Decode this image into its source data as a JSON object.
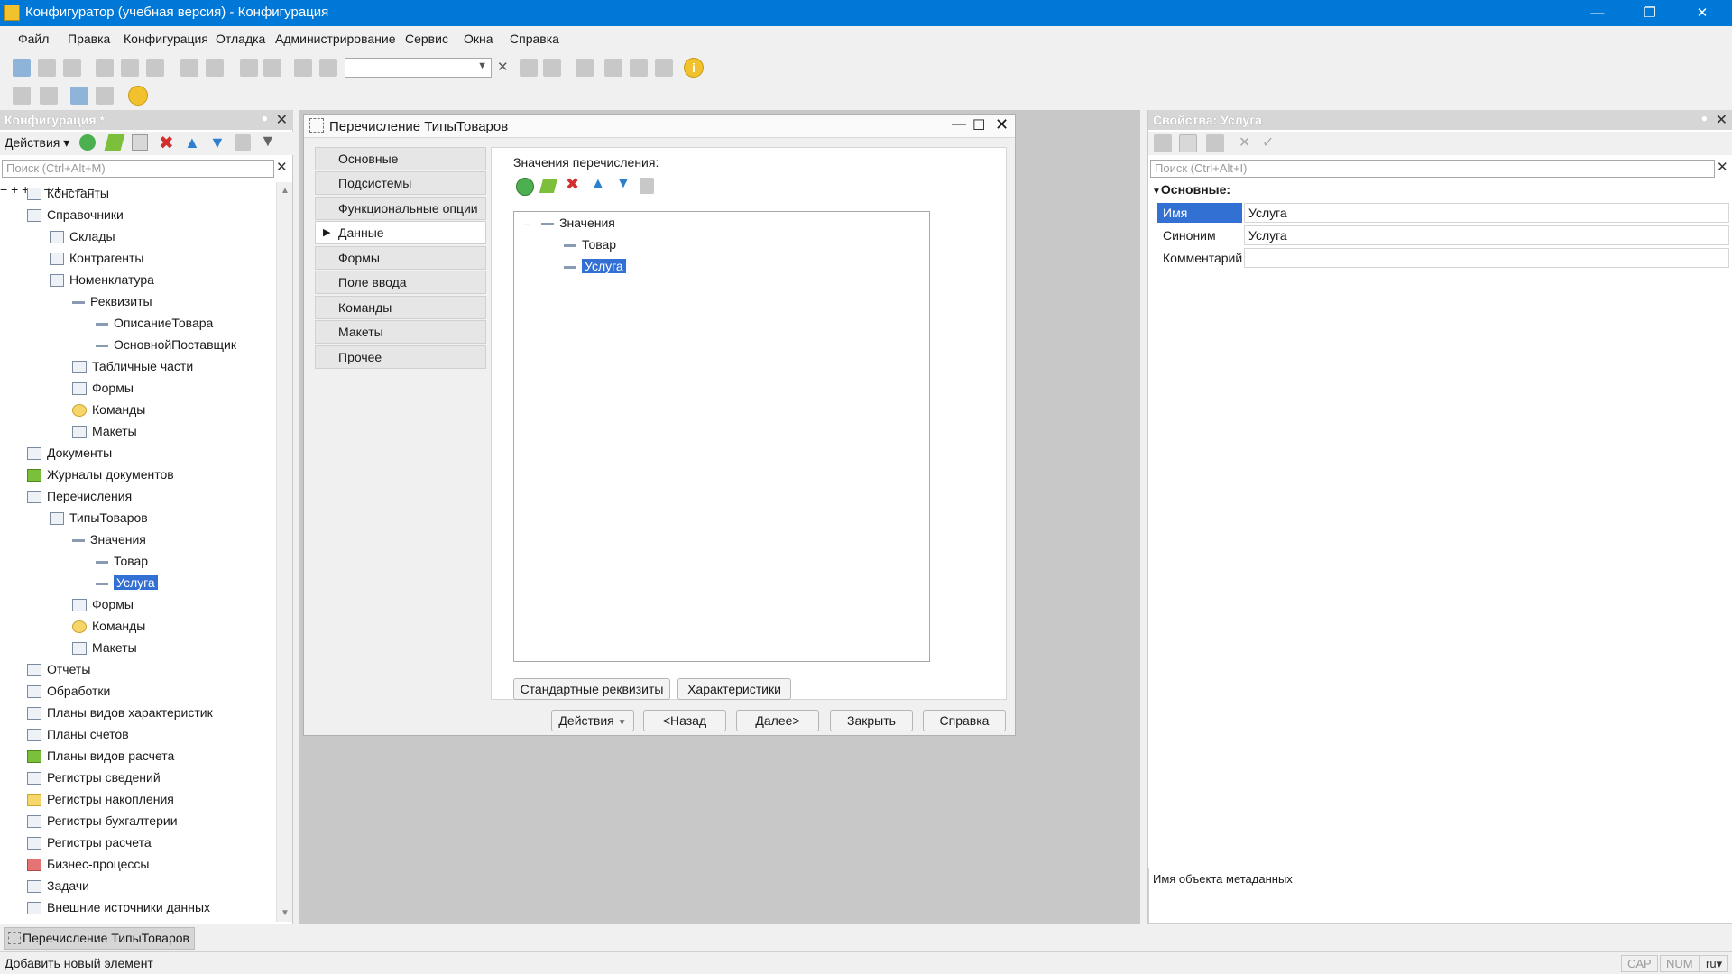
{
  "window": {
    "title": "Конфигуратор (учебная версия) - Конфигурация"
  },
  "menu": [
    "Файл",
    "Правка",
    "Конфигурация",
    "Отладка",
    "Администрирование",
    "Сервис",
    "Окна",
    "Справка"
  ],
  "left_panel": {
    "title": "Конфигурация *",
    "actions_label": "Действия",
    "search_placeholder": "Поиск (Ctrl+Alt+M)",
    "tree": [
      {
        "label": "Константы"
      },
      {
        "label": "Справочники"
      },
      {
        "label": "Склады"
      },
      {
        "label": "Контрагенты"
      },
      {
        "label": "Номенклатура"
      },
      {
        "label": "Реквизиты"
      },
      {
        "label": "ОписаниеТовара"
      },
      {
        "label": "ОсновнойПоставщик"
      },
      {
        "label": "Табличные части"
      },
      {
        "label": "Формы"
      },
      {
        "label": "Команды"
      },
      {
        "label": "Макеты"
      },
      {
        "label": "Документы"
      },
      {
        "label": "Журналы документов"
      },
      {
        "label": "Перечисления"
      },
      {
        "label": "ТипыТоваров"
      },
      {
        "label": "Значения"
      },
      {
        "label": "Товар"
      },
      {
        "label": "Услуга"
      },
      {
        "label": "Формы"
      },
      {
        "label": "Команды"
      },
      {
        "label": "Макеты"
      },
      {
        "label": "Отчеты"
      },
      {
        "label": "Обработки"
      },
      {
        "label": "Планы видов характеристик"
      },
      {
        "label": "Планы счетов"
      },
      {
        "label": "Планы видов расчета"
      },
      {
        "label": "Регистры сведений"
      },
      {
        "label": "Регистры накопления"
      },
      {
        "label": "Регистры бухгалтерии"
      },
      {
        "label": "Регистры расчета"
      },
      {
        "label": "Бизнес-процессы"
      },
      {
        "label": "Задачи"
      },
      {
        "label": "Внешние источники данных"
      }
    ]
  },
  "dialog": {
    "title": "Перечисление ТипыТоваров",
    "tabs": [
      "Основные",
      "Подсистемы",
      "Функциональные опции",
      "Данные",
      "Формы",
      "Поле ввода",
      "Команды",
      "Макеты",
      "Прочее"
    ],
    "values_label": "Значения перечисления:",
    "values_tree": {
      "root": "Значения",
      "items": [
        "Товар",
        "Услуга"
      ]
    },
    "buttons": {
      "standard_attrs": "Стандартные реквизиты",
      "characteristics": "Характеристики",
      "actions": "Действия",
      "back": "<Назад",
      "next": "Далее>",
      "close": "Закрыть",
      "help": "Справка"
    }
  },
  "properties": {
    "title": "Свойства: Услуга",
    "search_placeholder": "Поиск (Ctrl+Alt+I)",
    "section": "Основные:",
    "rows": [
      {
        "label": "Имя",
        "value": "Услуга"
      },
      {
        "label": "Синоним",
        "value": "Услуга"
      },
      {
        "label": "Комментарий",
        "value": ""
      }
    ],
    "description": "Имя объекта метаданных"
  },
  "taskbar": {
    "tab": "Перечисление ТипыТоваров"
  },
  "status": {
    "text": "Добавить новый элемент",
    "cap": "CAP",
    "num": "NUM",
    "lang": "ru"
  }
}
